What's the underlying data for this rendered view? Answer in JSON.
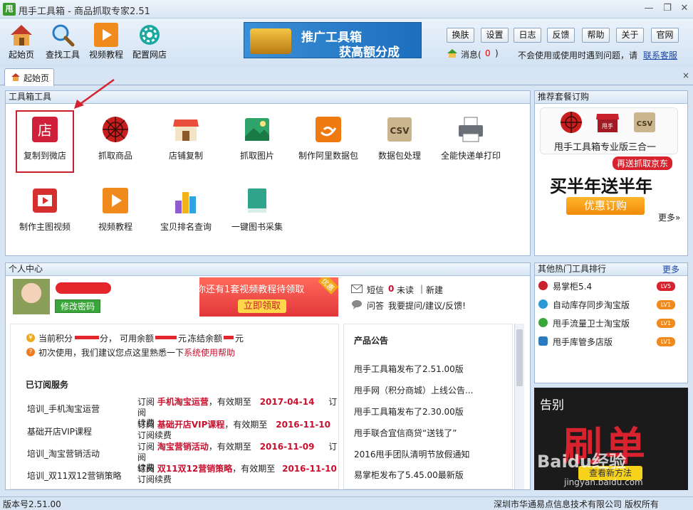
{
  "window": {
    "title": "甩手工具箱 - 商品抓取专家2.51",
    "app_icon_text": "甩"
  },
  "toolbar": {
    "buttons": [
      {
        "label": "起始页",
        "icon": "home-icon"
      },
      {
        "label": "查找工具",
        "icon": "magnifier-icon"
      },
      {
        "label": "视频教程",
        "icon": "play-icon"
      },
      {
        "label": "配置网店",
        "icon": "gear-icon"
      }
    ],
    "promo_line1": "推广工具箱",
    "promo_line2": "获高额分成",
    "small_buttons": [
      "换肤",
      "设置",
      "日志",
      "反馈",
      "帮助",
      "关于",
      "官网"
    ],
    "message_label": "消息(",
    "message_count": "0",
    "message_close": ")",
    "help_text": "不会使用或使用时遇到问题，请",
    "help_link": "联系客服"
  },
  "tabs": [
    {
      "label": "起始页",
      "icon": "home-icon"
    }
  ],
  "tools_panel": {
    "title": "工具箱工具",
    "items": [
      {
        "label": "复制到微店",
        "icon": "shop-icon",
        "highlighted": true
      },
      {
        "label": "抓取商品",
        "icon": "spider-icon"
      },
      {
        "label": "店铺复制",
        "icon": "store-icon"
      },
      {
        "label": "抓取图片",
        "icon": "picture-icon"
      },
      {
        "label": "制作阿里数据包",
        "icon": "ali-icon"
      },
      {
        "label": "数据包处理",
        "icon": "csv-icon"
      },
      {
        "label": "全能快递单打印",
        "icon": "printer-icon"
      },
      {
        "label": "制作主图视频",
        "icon": "video-icon"
      },
      {
        "label": "视频教程",
        "icon": "play-icon"
      },
      {
        "label": "宝贝排名查询",
        "icon": "ranking-icon"
      },
      {
        "label": "一键图书采集",
        "icon": "book-icon"
      }
    ]
  },
  "recommend_panel": {
    "title": "推荐套餐订购",
    "package_name": "甩手工具箱专业版三合一",
    "badge": "再送抓取京东",
    "headline": "买半年送半年",
    "cta": "优惠订购",
    "more": "更多»",
    "csv_text": "CSV",
    "shop_text": "甩手"
  },
  "personal_panel": {
    "title": "个人中心",
    "change_password": "修改密码",
    "banner_text": "你还有1套视频教程待领取",
    "banner_corner": "优惠",
    "banner_button": "立即领取",
    "sms_label": "短信",
    "sms_count": "0",
    "sms_unread": "未读",
    "sms_sep": "|",
    "sms_new": "新建",
    "ask_label": "问答",
    "ask_link": "我要提问/建议/反馈!",
    "points_prefix": "当前积分",
    "points_unit": "分，",
    "balance_label": "可用余额",
    "balance_unit": "元，",
    "frozen_label": "冻结余额",
    "frozen_unit": "元",
    "first_use": "初次使用，我们建议您点这里熟悉一下",
    "first_use_link": "系统使用帮助",
    "subscribed_title": "已订阅服务",
    "services": [
      {
        "name": "培训_手机淘宝运营",
        "prefix": "订阅",
        "product": "手机淘宝运营",
        "mid": "，有效期至",
        "date": "2017-04-14",
        "tail1": "订阅",
        "tail2": "续费"
      },
      {
        "name": "基础开店VIP课程",
        "prefix": "订阅",
        "product": "基础开店VIP课程",
        "mid": "，有效期至",
        "date": "2016-11-10",
        "tail1": "",
        "tail2": "订阅续费"
      },
      {
        "name": "培训_淘宝营销活动",
        "prefix": "订阅",
        "product": "淘宝营销活动",
        "mid": "，有效期至",
        "date": "2016-11-09",
        "tail1": "订阅",
        "tail2": "续费"
      },
      {
        "name": "培训_双11双12营销策略",
        "prefix": "订阅",
        "product": "双11双12营销策略",
        "mid": "，有效期至",
        "date": "2016-11-10",
        "tail1": "",
        "tail2": "订阅续费"
      }
    ],
    "notice_title": "产品公告",
    "notices": [
      "甩手工具箱发布了2.51.00版",
      "甩手网（积分商城）上线公告...",
      "甩手工具箱发布了2.30.00版",
      "甩手联合宜信商贷“送钱了”",
      "2016甩手团队清明节放假通知",
      "易掌柜发布了5.45.00最新版"
    ]
  },
  "hot_panel": {
    "title": "其他热门工具排行",
    "more": "更多",
    "items": [
      {
        "label": "易掌柜5.4",
        "badge": "LV5"
      },
      {
        "label": "自动库存同步淘宝版",
        "badge": "LV1"
      },
      {
        "label": "甩手流量卫士淘宝版",
        "badge": "LV1"
      },
      {
        "label": "甩手库管多店版",
        "badge": "LV1"
      }
    ]
  },
  "ad_panel": {
    "title": "告别",
    "big_text": "刷单",
    "button": "查看新方法",
    "watermark1": "Baidu经验",
    "watermark2": "jingyan.baidu.com"
  },
  "status": {
    "version": "版本号2.51.00",
    "company": "深圳市华通易点信息技术有限公司 版权所有"
  }
}
